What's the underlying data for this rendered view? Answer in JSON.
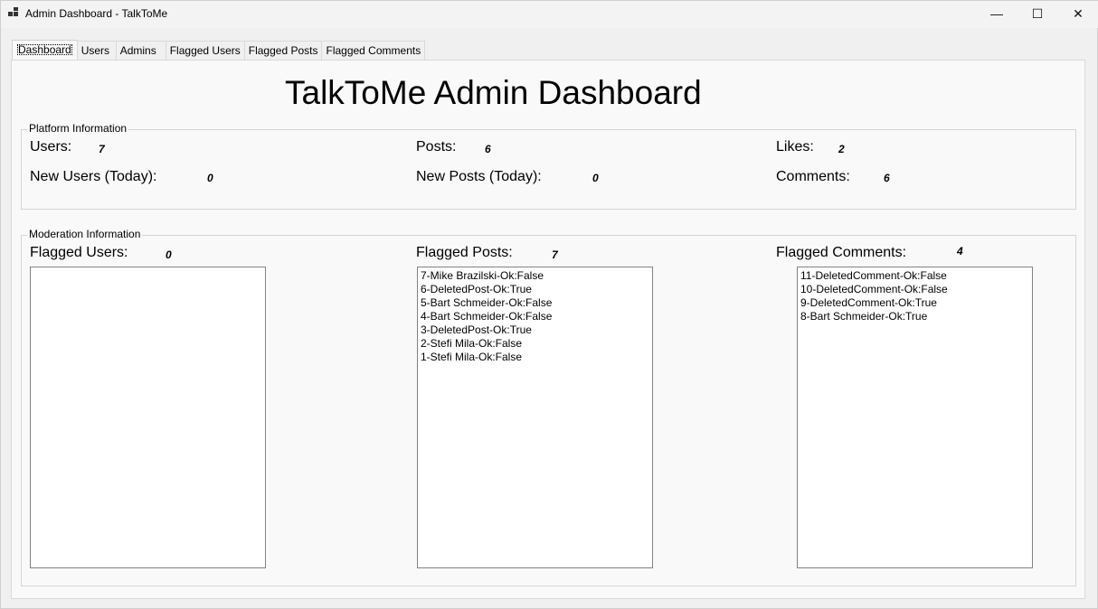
{
  "window": {
    "title": "Admin Dashboard - TalkToMe",
    "min_icon": "—",
    "max_icon": "☐",
    "close_icon": "✕"
  },
  "tabs": [
    "Dashboard",
    "Users",
    "Admins",
    "Flagged Users",
    "Flagged Posts",
    "Flagged Comments"
  ],
  "dashboard": {
    "title": "TalkToMe Admin Dashboard",
    "platform": {
      "legend": "Platform Information",
      "users_label": "Users:",
      "users_value": "7",
      "posts_label": "Posts:",
      "posts_value": "6",
      "likes_label": "Likes:",
      "likes_value": "2",
      "new_users_label": "New Users (Today):",
      "new_users_value": "0",
      "new_posts_label": "New Posts (Today):",
      "new_posts_value": "0",
      "comments_label": "Comments:",
      "comments_value": "6"
    },
    "moderation": {
      "legend": "Moderation Information",
      "flagged_users_label": "Flagged Users:",
      "flagged_users_value": "0",
      "flagged_posts_label": "Flagged Posts:",
      "flagged_posts_value": "7",
      "flagged_comments_label": "Flagged Comments:",
      "flagged_comments_value": "4",
      "flagged_users_list": [],
      "flagged_posts_list": [
        "7-Mike Brazilski-Ok:False",
        "6-DeletedPost-Ok:True",
        "5-Bart Schmeider-Ok:False",
        "4-Bart Schmeider-Ok:False",
        "3-DeletedPost-Ok:True",
        "2-Stefi Mila-Ok:False",
        "1-Stefi Mila-Ok:False"
      ],
      "flagged_comments_list": [
        "11-DeletedComment-Ok:False",
        "10-DeletedComment-Ok:False",
        "9-DeletedComment-Ok:True",
        "8-Bart Schmeider-Ok:True"
      ]
    }
  }
}
